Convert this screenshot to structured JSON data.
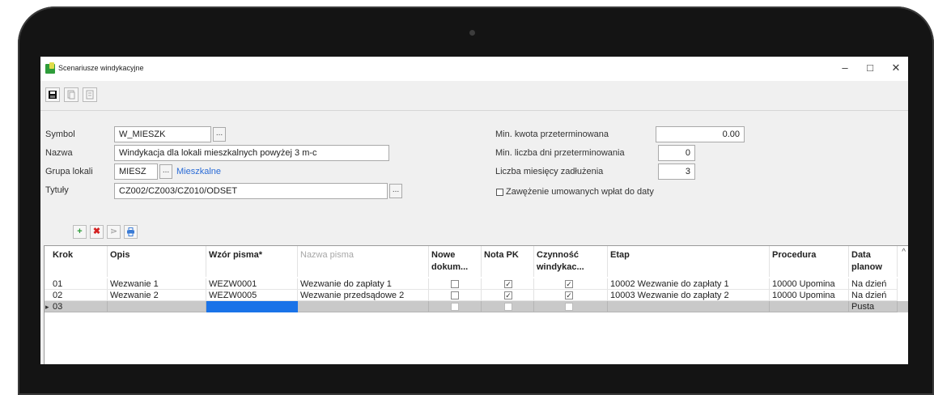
{
  "window": {
    "title": "Scenariusze windykacyjne",
    "controls": {
      "minimize": "–",
      "maximize": "□",
      "close": "✕"
    }
  },
  "form": {
    "symbol": {
      "label": "Symbol",
      "value": "W_MIESZK"
    },
    "nazwa": {
      "label": "Nazwa",
      "value": "Windykacja dla lokali mieszkalnych powyżej 3 m-c"
    },
    "grupa": {
      "label": "Grupa lokali",
      "value": "MIESZ",
      "link": "Mieszkalne"
    },
    "tytuly": {
      "label": "Tytuły",
      "value": "CZ002/CZ003/CZ010/ODSET"
    },
    "min_kwota": {
      "label": "Min. kwota przeterminowana",
      "value": "0.00"
    },
    "min_dni": {
      "label": "Min. liczba dni przeterminowania",
      "value": "0"
    },
    "liczba_miesiecy": {
      "label": "Liczba miesięcy zadłużenia",
      "value": "3"
    },
    "zawezenie": {
      "label": "Zawężenie umowanych wpłat do daty",
      "checked": false
    },
    "ellipsis": "..."
  },
  "grid": {
    "columns": [
      "Krok",
      "Opis",
      "Wzór pisma*",
      "Nazwa pisma",
      "Nowe dokum...",
      "Nota PK",
      "Czynność windykac...",
      "Etap",
      "Procedura",
      "Data planow"
    ],
    "rows": [
      {
        "krok": "01",
        "opis": "Wezwanie 1",
        "wzor": "WEZW0001",
        "nazwa": "Wezwanie do zapłaty 1",
        "nowe": false,
        "nota": true,
        "czynnosc": true,
        "etap": "10002 Wezwanie do zapłaty 1",
        "procedura": "10000 Upomina",
        "data": "Na dzień"
      },
      {
        "krok": "02",
        "opis": "Wezwanie 2",
        "wzor": "WEZW0005",
        "nazwa": "Wezwanie przedsądowe 2",
        "nowe": false,
        "nota": true,
        "czynnosc": true,
        "etap": "10003 Wezwanie do zapłaty 2",
        "procedura": "10000 Upomina",
        "data": "Na dzień"
      },
      {
        "krok": "03",
        "opis": "",
        "wzor": "",
        "nazwa": "",
        "nowe": false,
        "nota": false,
        "czynnosc": false,
        "etap": "",
        "procedura": "",
        "data": "Pusta"
      }
    ],
    "current_marker": "▸"
  },
  "colors": {
    "accent_link": "#2a6bd6",
    "selected_cell": "#1a73e8",
    "selected_row": "#c9c9c9"
  }
}
